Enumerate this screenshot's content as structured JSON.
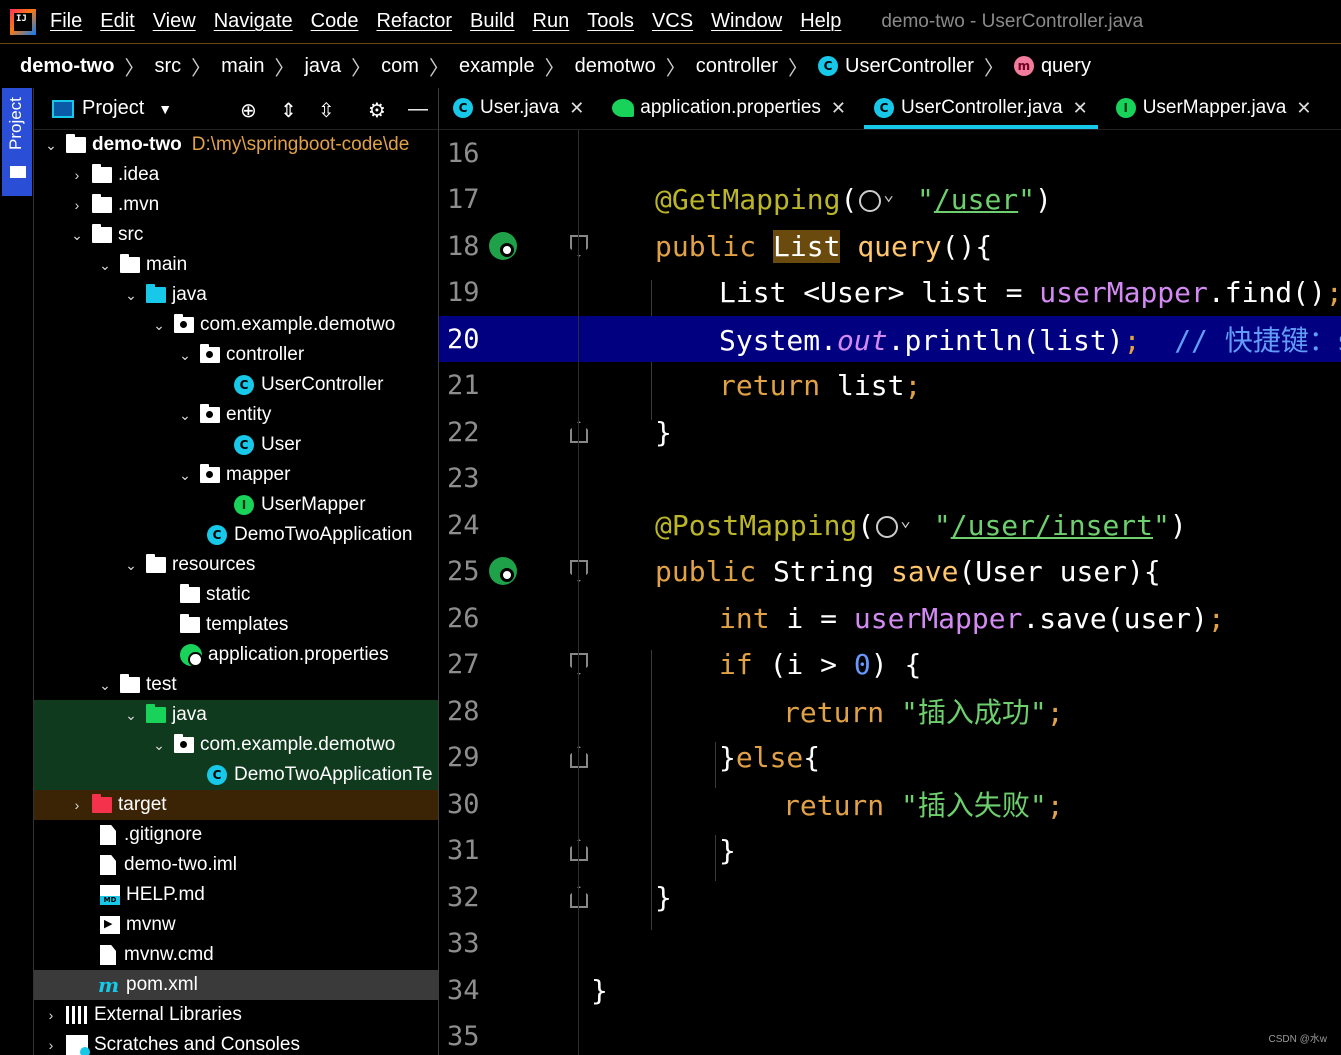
{
  "menu": {
    "items": [
      "File",
      "Edit",
      "View",
      "Navigate",
      "Code",
      "Refactor",
      "Build",
      "Run",
      "Tools",
      "VCS",
      "Window",
      "Help"
    ],
    "window_title": "demo-two - UserController.java"
  },
  "breadcrumb": {
    "items": [
      "demo-two",
      "src",
      "main",
      "java",
      "com",
      "example",
      "demotwo",
      "controller",
      "UserController",
      "query"
    ]
  },
  "toolstrip": {
    "project_tab": "Project"
  },
  "project_panel": {
    "title": "Project",
    "root_path": "D:\\my\\springboot-code\\de",
    "tree": [
      {
        "label": "demo-two",
        "depth": 0
      },
      {
        "label": ".idea",
        "depth": 1
      },
      {
        "label": ".mvn",
        "depth": 1
      },
      {
        "label": "src",
        "depth": 1
      },
      {
        "label": "main",
        "depth": 2
      },
      {
        "label": "java",
        "depth": 3
      },
      {
        "label": "com.example.demotwo",
        "depth": 4
      },
      {
        "label": "controller",
        "depth": 5
      },
      {
        "label": "UserController",
        "depth": 6
      },
      {
        "label": "entity",
        "depth": 5
      },
      {
        "label": "User",
        "depth": 6
      },
      {
        "label": "mapper",
        "depth": 5
      },
      {
        "label": "UserMapper",
        "depth": 6
      },
      {
        "label": "DemoTwoApplication",
        "depth": 5
      },
      {
        "label": "resources",
        "depth": 3
      },
      {
        "label": "static",
        "depth": 4
      },
      {
        "label": "templates",
        "depth": 4
      },
      {
        "label": "application.properties",
        "depth": 4
      },
      {
        "label": "test",
        "depth": 2
      },
      {
        "label": "java",
        "depth": 3
      },
      {
        "label": "com.example.demotwo",
        "depth": 4
      },
      {
        "label": "DemoTwoApplicationTe",
        "depth": 5
      },
      {
        "label": "target",
        "depth": 1
      },
      {
        "label": ".gitignore",
        "depth": 1
      },
      {
        "label": "demo-two.iml",
        "depth": 1
      },
      {
        "label": "HELP.md",
        "depth": 1
      },
      {
        "label": "mvnw",
        "depth": 1
      },
      {
        "label": "mvnw.cmd",
        "depth": 1
      },
      {
        "label": "pom.xml",
        "depth": 1
      },
      {
        "label": "External Libraries",
        "depth": 0
      },
      {
        "label": "Scratches and Consoles",
        "depth": 0
      }
    ]
  },
  "editor": {
    "tabs": [
      {
        "label": "User.java"
      },
      {
        "label": "application.properties"
      },
      {
        "label": "UserController.java",
        "active": true
      },
      {
        "label": "UserMapper.java"
      }
    ],
    "current_line": 20,
    "lines": [
      {
        "n": "16",
        "text": ""
      },
      {
        "n": "17",
        "text": "@GetMapping(\"/user\")"
      },
      {
        "n": "18",
        "text": "public List query(){"
      },
      {
        "n": "19",
        "text": "List <User> list = userMapper.find();"
      },
      {
        "n": "20",
        "text": "System.out.println(list);  // 快捷键：so"
      },
      {
        "n": "21",
        "text": "return list;"
      },
      {
        "n": "22",
        "text": "}"
      },
      {
        "n": "23",
        "text": ""
      },
      {
        "n": "24",
        "text": "@PostMapping(\"/user/insert\")"
      },
      {
        "n": "25",
        "text": "public String save(User user){"
      },
      {
        "n": "26",
        "text": "int i = userMapper.save(user);"
      },
      {
        "n": "27",
        "text": "if (i > 0) {"
      },
      {
        "n": "28",
        "text": "return \"插入成功\";"
      },
      {
        "n": "29",
        "text": "}else{"
      },
      {
        "n": "30",
        "text": "return \"插入失败\";"
      },
      {
        "n": "31",
        "text": "}"
      },
      {
        "n": "32",
        "text": "}"
      },
      {
        "n": "33",
        "text": ""
      },
      {
        "n": "34",
        "text": "}"
      },
      {
        "n": "35",
        "text": ""
      }
    ]
  },
  "watermark": "CSDN @水w"
}
